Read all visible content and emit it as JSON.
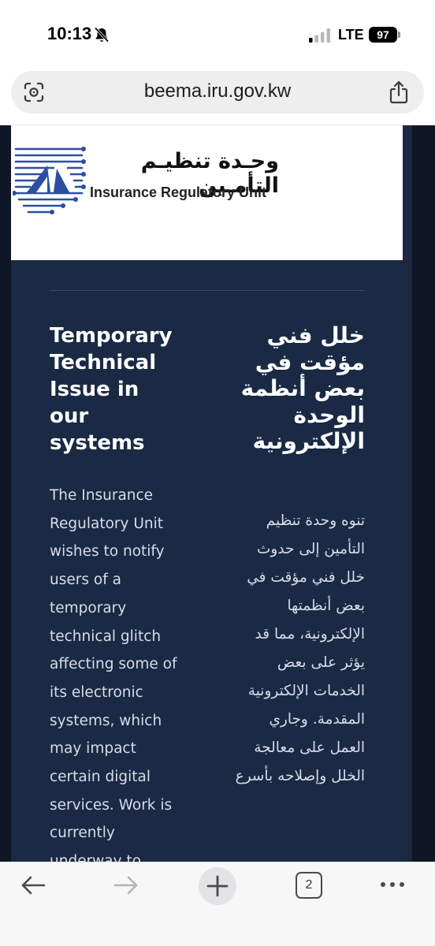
{
  "status_bar": {
    "time": "10:13",
    "network": "LTE",
    "battery": "97",
    "icons": [
      "bell-muted-icon",
      "signal-icon"
    ]
  },
  "browser": {
    "url": "beema.iru.gov.kw",
    "icons": [
      "lens-icon",
      "share-icon"
    ]
  },
  "logo": {
    "arabic_name": "وحـدة تنظيـم التأمـين",
    "english_name": "Insurance Regulatory Unit"
  },
  "notice": {
    "title_en": "Temporary Technical Issue in our systems",
    "body_en": "The Insurance Regulatory Unit wishes to notify users of a temporary technical glitch affecting some of its electronic systems, which may impact certain digital services. Work is currently underway to",
    "title_ar": "خلل فني مؤقت في بعض أنظمة الوحدة الإلكترونية",
    "body_ar": "تنوه وحدة تنظيم التأمين إلى حدوث خلل فني مؤقت في بعض أنظمتها الإلكترونية، مما قد يؤثر على بعض الخدمات الإلكترونية المقدمة. وجاري العمل على معالجة الخلل وإصلاحه بأسرع"
  },
  "toolbar": {
    "tab_count": "2",
    "icons": [
      "back-arrow-icon",
      "forward-arrow-icon",
      "plus-icon",
      "more-dots-icon"
    ]
  },
  "colors": {
    "page_background": "#1a2a45",
    "heading_text": "#ffffff",
    "body_text": "#d8dde7",
    "logo_blue": "#2b4fa0"
  }
}
